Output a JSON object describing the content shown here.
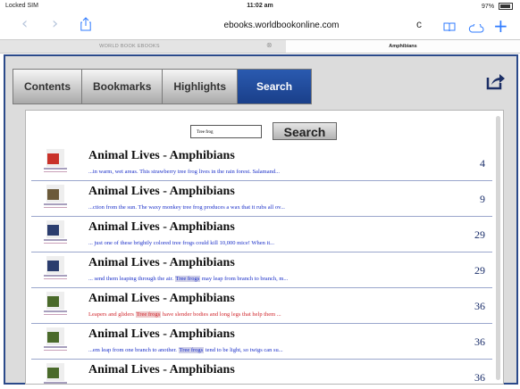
{
  "status_bar": {
    "carrier": "Locked SIM",
    "time": "11:02 am",
    "battery": "97%"
  },
  "browser": {
    "url": "ebooks.worldbookonline.com",
    "tabs": [
      {
        "label": "WORLD BOOK EBOOKS"
      },
      {
        "label": "Amphibians"
      }
    ]
  },
  "app": {
    "tabs": [
      {
        "label": "Contents"
      },
      {
        "label": "Bookmarks"
      },
      {
        "label": "Highlights"
      },
      {
        "label": "Search",
        "active": true
      }
    ],
    "search": {
      "value": "Tree frog",
      "button_label": "Search"
    },
    "results": [
      {
        "title": "Animal Lives - Amphibians",
        "snippet_pre": "...in warm, wet areas. This strawberry tree frog lives in the rain forest. Salamand...",
        "snippet_hl": "",
        "snippet_post": "",
        "page": "4",
        "style": "blue",
        "thumb_color": "#c9322a"
      },
      {
        "title": "Animal Lives - Amphibians",
        "snippet_pre": "...ction from the sun. The waxy monkey tree frog produces a wax that it rubs all ov...",
        "snippet_hl": "",
        "snippet_post": "",
        "page": "9",
        "style": "blue",
        "thumb_color": "#6b5a3a"
      },
      {
        "title": "Animal Lives - Amphibians",
        "snippet_pre": "... just one of these brightly colored tree frogs could kill 10,000 mice!   When it...",
        "snippet_hl": "",
        "snippet_post": "",
        "page": "29",
        "style": "blue",
        "thumb_color": "#2b3d6e"
      },
      {
        "title": "Animal Lives - Amphibians",
        "snippet_pre": "... send them leaping through the air. ",
        "snippet_hl": "Tree frogs",
        "snippet_post": " may leap from branch to branch, m...",
        "page": "29",
        "style": "blue",
        "thumb_color": "#2b3d6e"
      },
      {
        "title": "Animal Lives - Amphibians",
        "snippet_pre": "Leapers and gliders ",
        "snippet_hl": "Tree frogs",
        "snippet_post": " have slender bodies and long legs that help them ...",
        "page": "36",
        "style": "red",
        "thumb_color": "#4a6a2a"
      },
      {
        "title": "Animal Lives - Amphibians",
        "snippet_pre": "...em leap from one branch to another. ",
        "snippet_hl": "Tree frogs",
        "snippet_post": " tend to be light, so twigs can su...",
        "page": "36",
        "style": "blue",
        "thumb_color": "#4a6a2a"
      },
      {
        "title": "Animal Lives - Amphibians",
        "snippet_pre": "",
        "snippet_hl": "",
        "snippet_post": "",
        "page": "36",
        "style": "blue",
        "thumb_color": "#4a6a2a"
      }
    ]
  },
  "colors": {
    "accent_blue": "#1a3f8a",
    "highlight": "#cfcfe8",
    "link_blue": "#1a2fc8",
    "match_red": "#d1262c"
  }
}
